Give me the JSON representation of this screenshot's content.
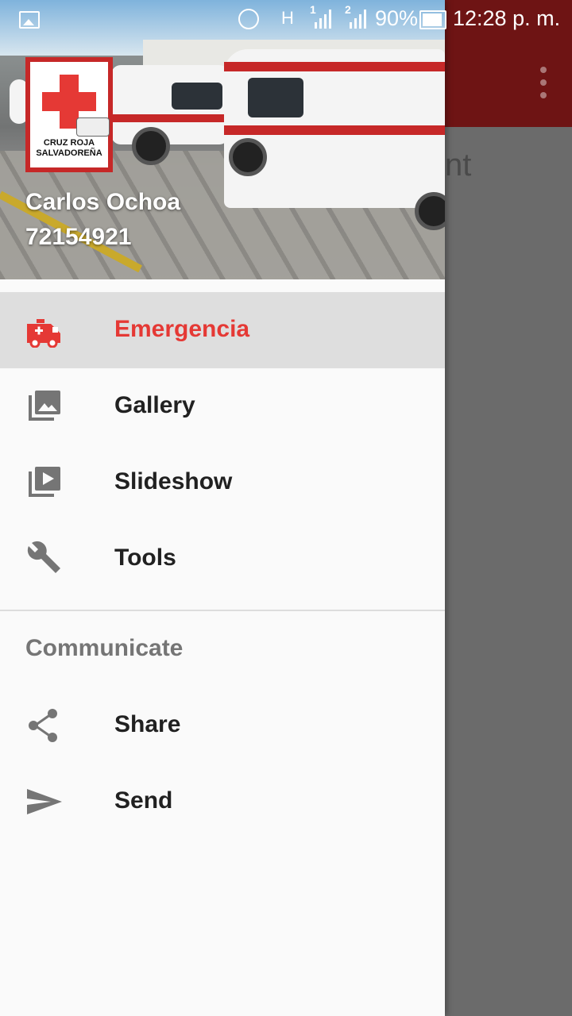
{
  "status_bar": {
    "network": "H",
    "sim1": "1",
    "sim2": "2",
    "battery": "90%",
    "time": "12:28 p. m."
  },
  "background_app": {
    "partial_text": "nt"
  },
  "drawer": {
    "logo": {
      "line1": "CRUZ ROJA",
      "line2": "SALVADOREÑA"
    },
    "user_name": "Carlos Ochoa",
    "user_phone": "72154921",
    "items": [
      {
        "label": "Emergencia",
        "icon": "ambulance-icon",
        "selected": true
      },
      {
        "label": "Gallery",
        "icon": "gallery-icon"
      },
      {
        "label": "Slideshow",
        "icon": "slideshow-icon"
      },
      {
        "label": "Tools",
        "icon": "wrench-icon"
      }
    ],
    "section_title": "Communicate",
    "section_items": [
      {
        "label": "Share",
        "icon": "share-icon"
      },
      {
        "label": "Send",
        "icon": "send-icon"
      }
    ]
  },
  "colors": {
    "accent": "#e53935",
    "toolbar_dimmed": "#6e1414"
  }
}
